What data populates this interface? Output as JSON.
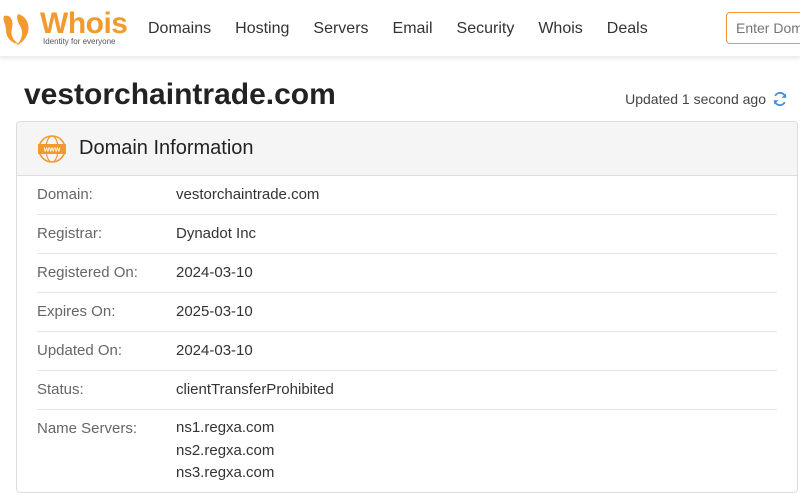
{
  "header": {
    "logo": {
      "word": "Whois",
      "tagline": "Identity for everyone"
    },
    "nav": [
      "Domains",
      "Hosting",
      "Servers",
      "Email",
      "Security",
      "Whois",
      "Deals"
    ],
    "search": {
      "placeholder": "Enter Domain or IP"
    }
  },
  "page": {
    "title": "vestorchaintrade.com",
    "updated": "Updated 1 second ago"
  },
  "card": {
    "title": "Domain Information",
    "icon_text": "www",
    "rows": [
      {
        "label": "Domain:",
        "value": "vestorchaintrade.com"
      },
      {
        "label": "Registrar:",
        "value": "Dynadot Inc"
      },
      {
        "label": "Registered On:",
        "value": "2024-03-10"
      },
      {
        "label": "Expires On:",
        "value": "2025-03-10"
      },
      {
        "label": "Updated On:",
        "value": "2024-03-10"
      },
      {
        "label": "Status:",
        "value": "clientTransferProhibited"
      }
    ],
    "name_servers": {
      "label": "Name Servers:",
      "values": [
        "ns1.regxa.com",
        "ns2.regxa.com",
        "ns3.regxa.com"
      ]
    }
  },
  "colors": {
    "accent": "#f29a2e",
    "refresh": "#3b8fd9"
  }
}
